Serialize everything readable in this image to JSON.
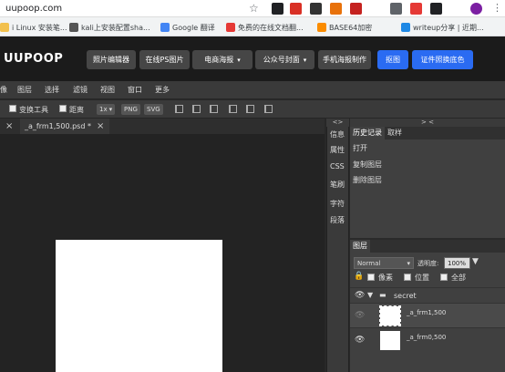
{
  "browser": {
    "url": "uupoop.com",
    "extensions": [
      {
        "name": "ext-1",
        "color": "#202124"
      },
      {
        "name": "ext-2",
        "color": "#d93025"
      },
      {
        "name": "ext-3",
        "color": "#333333"
      },
      {
        "name": "ext-4",
        "color": "#e8710a"
      },
      {
        "name": "ext-5",
        "color": "#c5221f"
      },
      {
        "name": "ext-6",
        "color": "#5f6368"
      },
      {
        "name": "ext-7",
        "color": "#e53935"
      },
      {
        "name": "ext-8",
        "color": "#202124"
      }
    ]
  },
  "bookmarks": [
    {
      "label": "i Linux 安装笔...",
      "color": "#f2c04d"
    },
    {
      "label": "kali上安装配置sha...",
      "color": "#555555"
    },
    {
      "label": "Google 翻译",
      "color": "#4285f4"
    },
    {
      "label": "免费的在线文档翻...",
      "color": "#e53935"
    },
    {
      "label": "BASE64加密",
      "color": "#fb8c00"
    },
    {
      "label": "writeup分享 | 近期...",
      "color": "#1e88e5"
    }
  ],
  "app": {
    "logo": "UUPOOP",
    "header_buttons": [
      {
        "label": "照片编辑器",
        "dropdown": false,
        "style": "dark"
      },
      {
        "label": "在线PS图片",
        "dropdown": false,
        "style": "dark"
      },
      {
        "label": "电商海报",
        "dropdown": true,
        "style": "dark"
      },
      {
        "label": "公众号封面",
        "dropdown": true,
        "style": "dark"
      },
      {
        "label": "手机海报制作",
        "dropdown": false,
        "style": "dark"
      },
      {
        "label": "抠图",
        "dropdown": false,
        "style": "blue"
      },
      {
        "label": "证件照换底色",
        "dropdown": false,
        "style": "blue"
      }
    ],
    "caret": "▾"
  },
  "menu": [
    "像",
    "图层",
    "选择",
    "滤镜",
    "视图",
    "窗口",
    "更多"
  ],
  "options": {
    "transform_label": "变换工具",
    "distance_label": "距离",
    "zoom_value": "1x",
    "png_label": "PNG",
    "svg_label": "SVG"
  },
  "tabs": [
    {
      "label": "",
      "close": "×"
    },
    {
      "label": "_a_frm1,500.psd *",
      "close": "×"
    }
  ],
  "collapse": {
    "left": "<>",
    "right": ">  <"
  },
  "side_icons": [
    "信息",
    "属性",
    "CSS",
    "笔刷",
    "字符",
    "段落"
  ],
  "history": {
    "tabs": [
      "历史记录",
      "取样"
    ],
    "items": [
      "打开",
      "复制图层",
      "删除图层"
    ]
  },
  "layers": {
    "tab": "图层",
    "blend_mode": "Normal",
    "opacity_label": "透明度:",
    "opacity_value": "100%",
    "lock_icon_label": "",
    "lock_pixels": "像素",
    "lock_position": "位置",
    "lock_all": "全部",
    "group_name": "secret",
    "items": [
      {
        "name": "_a_frm1,500",
        "visible": false,
        "selected": true
      },
      {
        "name": "_a_frm0,500",
        "visible": true,
        "selected": false
      }
    ]
  }
}
